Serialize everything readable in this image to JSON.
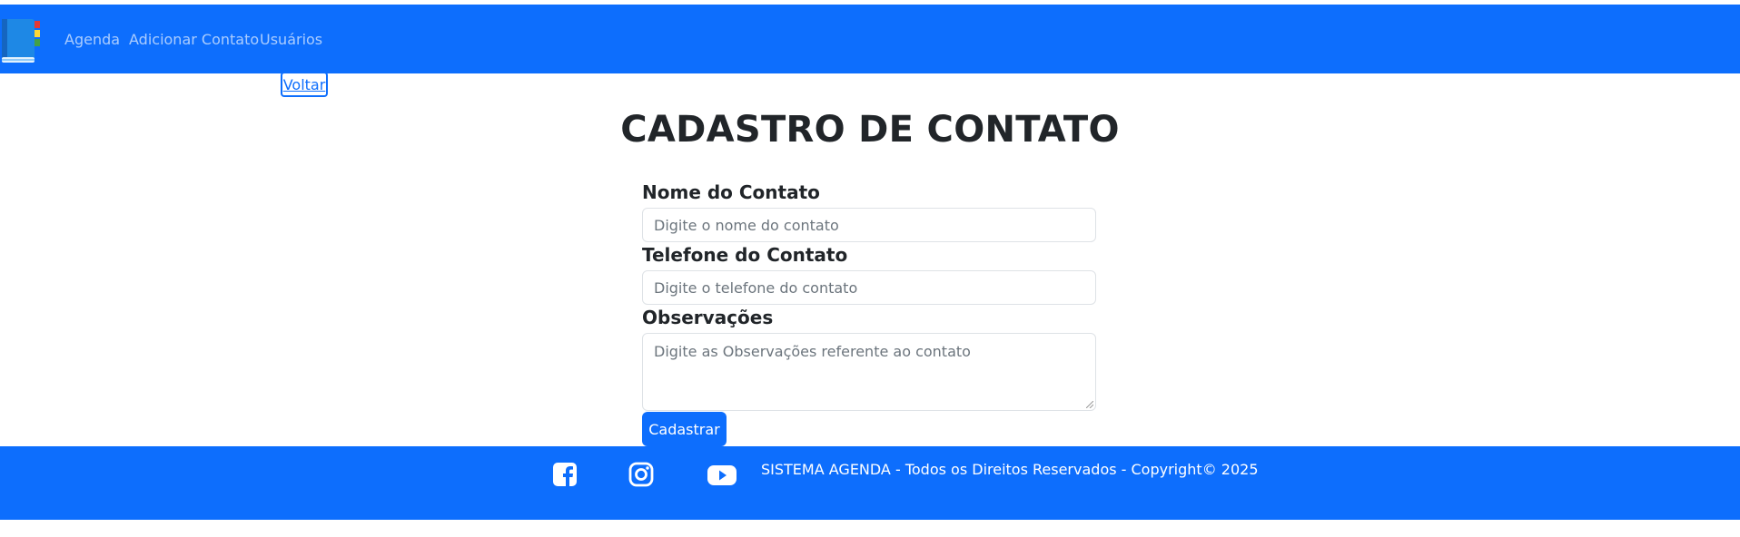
{
  "navbar": {
    "logo_icon": "address-book-icon",
    "links": [
      {
        "label": "Agenda"
      },
      {
        "label": "Adicionar Contato"
      },
      {
        "label": "Usuários"
      }
    ]
  },
  "back_link": {
    "label": "Voltar"
  },
  "page": {
    "title": "CADASTRO DE CONTATO"
  },
  "form": {
    "name": {
      "label": "Nome do Contato",
      "placeholder": "Digite o nome do contato",
      "value": ""
    },
    "phone": {
      "label": "Telefone do Contato",
      "placeholder": "Digite o telefone do contato",
      "value": ""
    },
    "notes": {
      "label": "Observações",
      "placeholder": "Digite as Observações referente ao contato",
      "value": ""
    },
    "submit_label": "Cadastrar"
  },
  "footer": {
    "social_icons": [
      "facebook-icon",
      "instagram-icon",
      "youtube-icon"
    ],
    "copyright": "SISTEMA AGENDA - Todos os Direitos Reservados - Copyright© 2025"
  },
  "colors": {
    "primary": "#0d6efd",
    "text": "#212529",
    "placeholder": "#6c757d"
  }
}
